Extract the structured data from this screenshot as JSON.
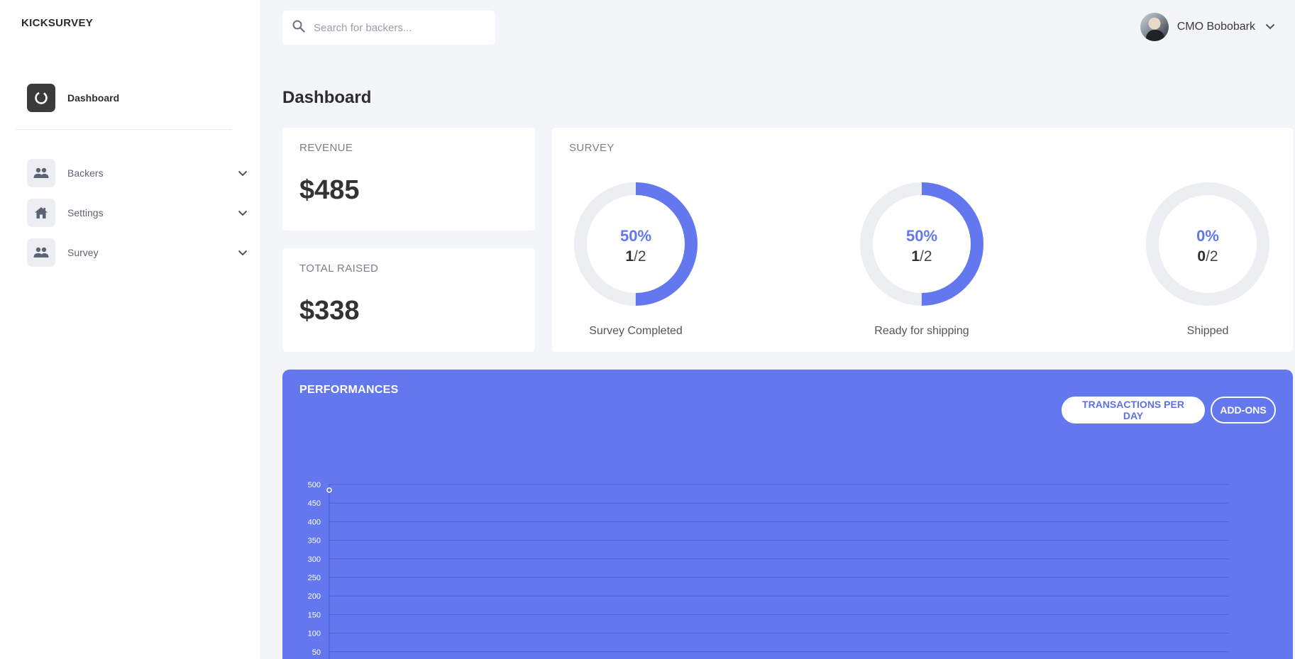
{
  "app": {
    "brand": "KICKSURVEY"
  },
  "sidebar": {
    "main": {
      "label": "Dashboard",
      "icon": "dashboard-ring-icon"
    },
    "items": [
      {
        "label": "Backers",
        "icon": "people-icon"
      },
      {
        "label": "Settings",
        "icon": "home-icon"
      },
      {
        "label": "Survey",
        "icon": "people-icon"
      }
    ]
  },
  "search": {
    "placeholder": "Search for backers..."
  },
  "user": {
    "name": "CMO Bobobark"
  },
  "page": {
    "title": "Dashboard"
  },
  "stats": {
    "revenue": {
      "label": "REVENUE",
      "value": "$485"
    },
    "total_raised": {
      "label": "TOTAL RAISED",
      "value": "$338"
    }
  },
  "survey": {
    "title": "SURVEY",
    "items": [
      {
        "percent": "50%",
        "done": "1",
        "total": "2",
        "caption": "Survey Completed",
        "fraction": 0.5
      },
      {
        "percent": "50%",
        "done": "1",
        "total": "2",
        "caption": "Ready for shipping",
        "fraction": 0.5
      },
      {
        "percent": "0%",
        "done": "0",
        "total": "2",
        "caption": "Shipped",
        "fraction": 0.0
      }
    ]
  },
  "performances": {
    "title": "PERFORMANCES",
    "buttons": {
      "transactions": "TRANSACTIONS PER DAY",
      "addons": "ADD-ONS"
    }
  },
  "colors": {
    "accent": "#6378ef",
    "track": "#eceef2",
    "sidebar_bg": "#ffffff",
    "page_bg": "#f4f5f9"
  },
  "chart_data": {
    "type": "line",
    "title": "",
    "xlabel": "",
    "ylabel": "",
    "y_ticks": [
      500,
      450,
      400,
      350,
      300,
      250,
      200,
      150,
      100,
      50
    ],
    "ylim": [
      0,
      500
    ],
    "grid": true,
    "series": [
      {
        "values": [
          485
        ]
      }
    ]
  }
}
